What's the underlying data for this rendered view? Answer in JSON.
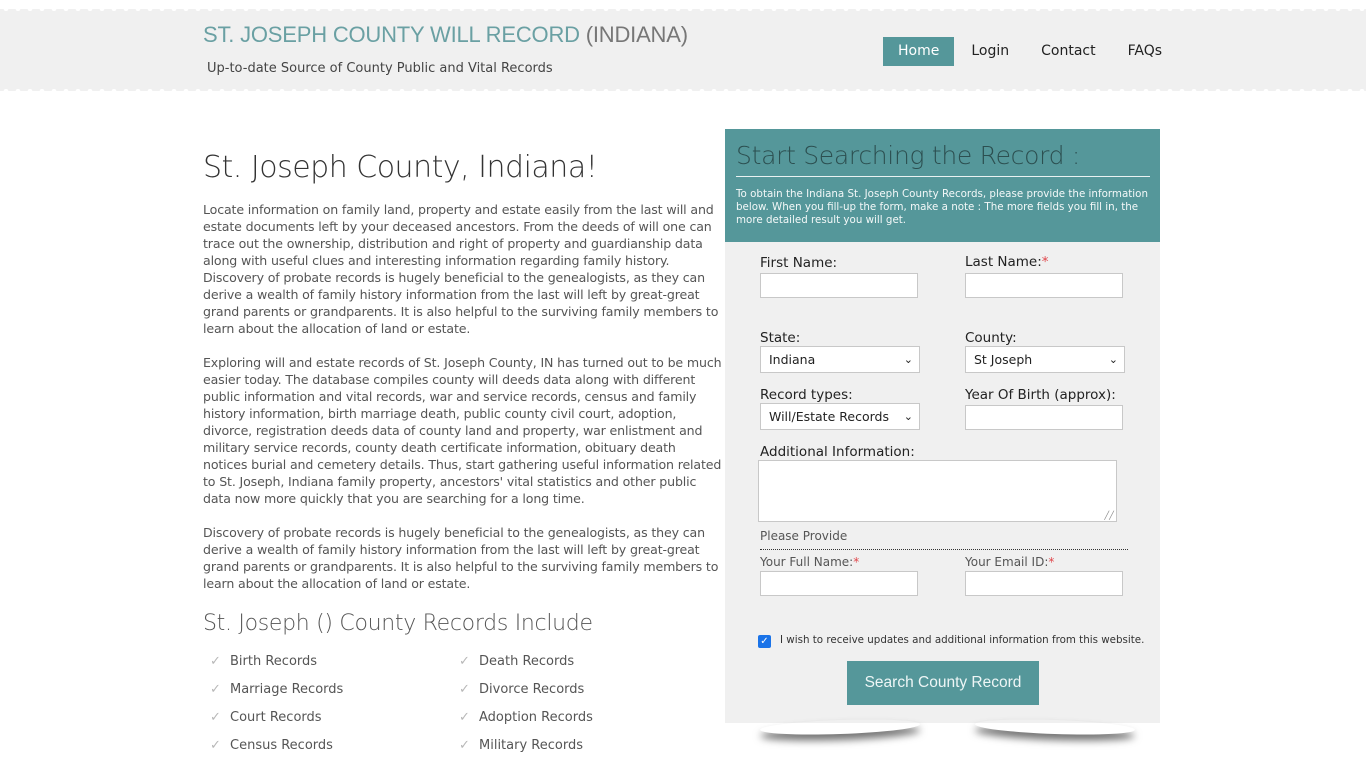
{
  "header": {
    "title_main": "ST. JOSEPH COUNTY WILL RECORD",
    "title_suffix": " (INDIANA)",
    "tagline": "Up-to-date Source of  County Public and Vital Records",
    "nav": [
      {
        "label": "Home",
        "active": true
      },
      {
        "label": "Login",
        "active": false
      },
      {
        "label": "Contact",
        "active": false
      },
      {
        "label": "FAQs",
        "active": false
      }
    ]
  },
  "main": {
    "title": "St. Joseph County, Indiana!",
    "paragraphs": [
      "Locate information on family land, property and estate easily from the last will and estate documents left by your deceased ancestors. From the deeds of will one can trace out the ownership, distribution and right of property and guardianship data along with useful clues and interesting information regarding family history. Discovery of probate records is hugely beneficial to the genealogists, as they can derive a wealth of family history information from the last will left by great-great grand parents or grandparents. It is also helpful to the surviving family members to learn about the allocation of land or estate.",
      "Exploring will and estate records of St. Joseph County, IN has turned out to be much easier today. The database compiles county will deeds data along with different public information and vital records, war and service records, census and family history information, birth marriage death, public county civil court, adoption, divorce, registration deeds data of county land and property, war enlistment and military service records, county death certificate information, obituary death notices burial and cemetery details. Thus, start gathering useful information related to St. Joseph, Indiana family property, ancestors' vital statistics and other public data now more quickly that you are searching for a long time.",
      "Discovery of probate records is hugely beneficial to the genealogists, as they can derive a wealth of family history information from the last will left by great-great grand parents or grandparents. It is also helpful to the surviving family members to learn about the allocation of land or estate."
    ],
    "records_title": "St. Joseph () County Records Include",
    "records": [
      "Birth Records",
      "Death Records",
      "Marriage Records",
      "Divorce Records",
      "Court Records",
      "Adoption Records",
      "Census Records",
      "Military Records"
    ],
    "check_icon": "✓"
  },
  "form": {
    "title": "Start Searching the Record :",
    "description": "To obtain the Indiana St. Joseph County Records, please provide the information below. When you fill-up the form, make a note : The more fields you fill in, the more detailed result you will get.",
    "first_name_label": "First Name:",
    "last_name_label": "Last Name:",
    "required_mark": "*",
    "state_label": "State:",
    "state_value": "Indiana",
    "county_label": "County:",
    "county_value": "St Joseph",
    "record_types_label": "Record types:",
    "record_types_value": "Will/Estate Records",
    "year_of_birth_label": "Year Of Birth (approx):",
    "additional_info_label": "Additional Information:",
    "please_provide": "Please Provide",
    "full_name_label": "Your Full Name:",
    "email_label": "Your Email ID:",
    "first_name_value": "",
    "last_name_value": "",
    "year_of_birth_value": "",
    "additional_info_value": "",
    "full_name_value": "",
    "email_value": "",
    "updates_checked": true,
    "updates_label": "I wish to receive updates and additional information from this website.",
    "submit_label": "Search County Record",
    "chevron_icon": "❯"
  },
  "colors": {
    "accent": "#55979a",
    "title_teal": "#6aa0a3",
    "required": "#e0474c",
    "header_bg": "#f0f0f0"
  }
}
